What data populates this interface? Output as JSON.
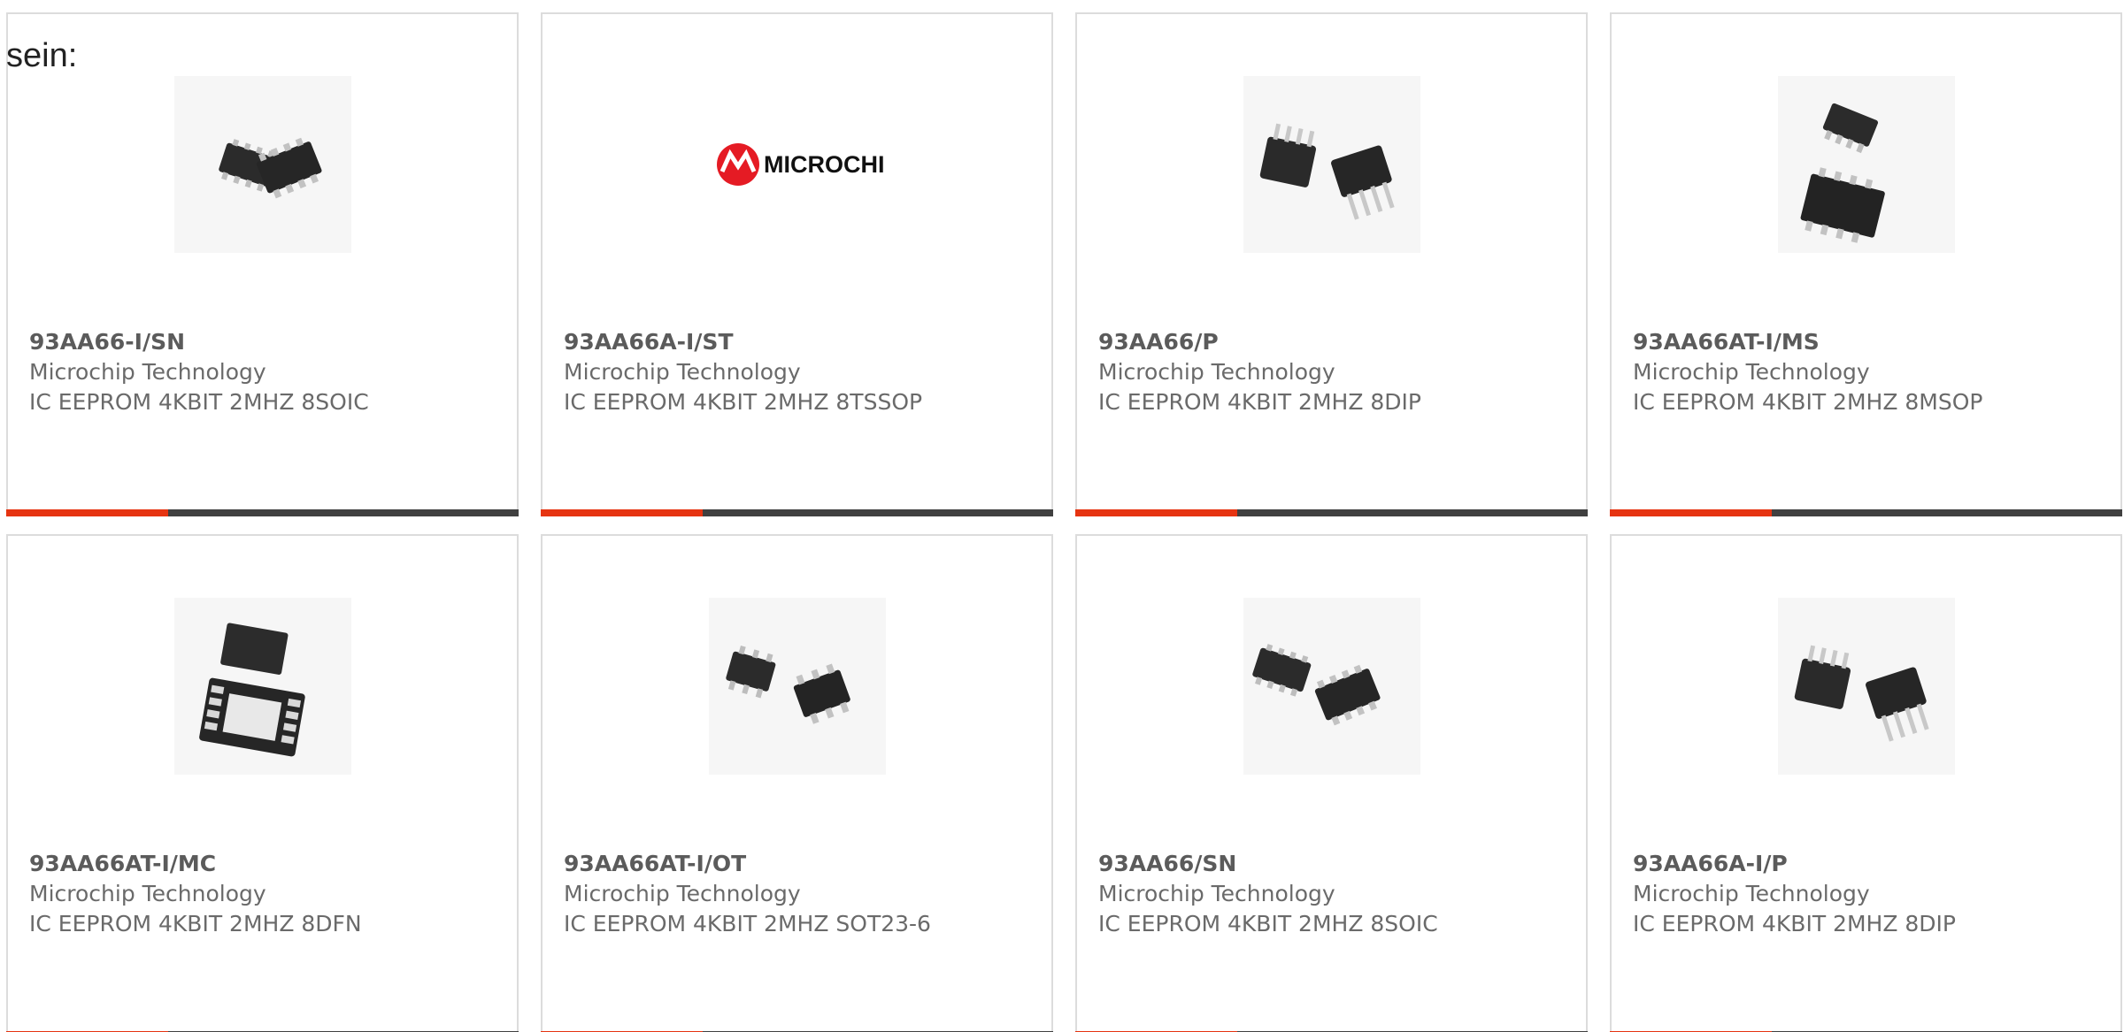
{
  "intro_text": "sein:",
  "colors": {
    "accent": "#e63411",
    "bar_dark": "#404040",
    "microchip_red": "#e51b24"
  },
  "products": [
    {
      "part_number": "93AA66-I/SN",
      "manufacturer": "Microchip Technology",
      "description": "IC EEPROM 4KBIT 2MHZ 8SOIC",
      "image_icon": "soic-8-chips-image"
    },
    {
      "part_number": "93AA66A-I/ST",
      "manufacturer": "Microchip Technology",
      "description": "IC EEPROM 4KBIT 2MHZ 8TSSOP",
      "image_icon": "microchip-logo-image",
      "logo_text": "MICROCHIP"
    },
    {
      "part_number": "93AA66/P",
      "manufacturer": "Microchip Technology",
      "description": "IC EEPROM 4KBIT 2MHZ 8DIP",
      "image_icon": "dip-8-chips-image"
    },
    {
      "part_number": "93AA66AT-I/MS",
      "manufacturer": "Microchip Technology",
      "description": "IC EEPROM 4KBIT 2MHZ 8MSOP",
      "image_icon": "msop-8-chips-image"
    },
    {
      "part_number": "93AA66AT-I/MC",
      "manufacturer": "Microchip Technology",
      "description": "IC EEPROM 4KBIT 2MHZ 8DFN",
      "image_icon": "dfn-8-chips-image"
    },
    {
      "part_number": "93AA66AT-I/OT",
      "manufacturer": "Microchip Technology",
      "description": "IC EEPROM 4KBIT 2MHZ SOT23-6",
      "image_icon": "sot23-6-chips-image"
    },
    {
      "part_number": "93AA66/SN",
      "manufacturer": "Microchip Technology",
      "description": "IC EEPROM 4KBIT 2MHZ 8SOIC",
      "image_icon": "soic-8-chips-image"
    },
    {
      "part_number": "93AA66A-I/P",
      "manufacturer": "Microchip Technology",
      "description": "IC EEPROM 4KBIT 2MHZ 8DIP",
      "image_icon": "dip-8-chips-image"
    }
  ]
}
